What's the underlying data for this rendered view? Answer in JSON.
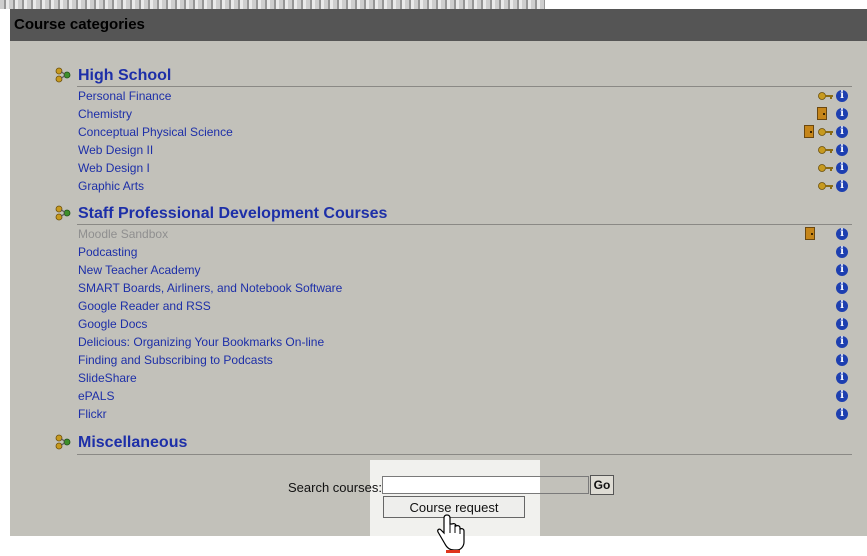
{
  "header": {
    "title": "Course categories"
  },
  "categories": [
    {
      "name": "High School",
      "courses": [
        {
          "name": "Personal Finance",
          "icons": [
            "key-icon",
            "info-icon"
          ]
        },
        {
          "name": "Chemistry",
          "icons": [
            "door-icon",
            "info-icon"
          ]
        },
        {
          "name": "Conceptual Physical Science",
          "icons": [
            "door-icon",
            "key-icon",
            "info-icon"
          ]
        },
        {
          "name": "Web Design II",
          "icons": [
            "key-icon",
            "info-icon"
          ]
        },
        {
          "name": "Web Design I",
          "icons": [
            "key-icon",
            "info-icon"
          ]
        },
        {
          "name": "Graphic Arts",
          "icons": [
            "key-icon",
            "info-icon"
          ]
        }
      ]
    },
    {
      "name": "Staff Professional Development Courses",
      "courses": [
        {
          "name": "Moodle Sandbox",
          "hidden": true,
          "icons": [
            "door-icon",
            "info-icon"
          ]
        },
        {
          "name": "Podcasting",
          "icons": [
            "info-icon"
          ]
        },
        {
          "name": "New Teacher Academy",
          "icons": [
            "info-icon"
          ]
        },
        {
          "name": "SMART Boards, Airliners, and Notebook Software",
          "icons": [
            "info-icon"
          ]
        },
        {
          "name": "Google Reader and RSS",
          "icons": [
            "info-icon"
          ]
        },
        {
          "name": "Google Docs",
          "icons": [
            "info-icon"
          ]
        },
        {
          "name": "Delicious: Organizing Your Bookmarks On-line",
          "icons": [
            "info-icon"
          ]
        },
        {
          "name": "Finding and Subscribing to Podcasts",
          "icons": [
            "info-icon"
          ]
        },
        {
          "name": "SlideShare",
          "icons": [
            "info-icon"
          ]
        },
        {
          "name": "ePALS",
          "icons": [
            "info-icon"
          ]
        },
        {
          "name": "Flickr",
          "icons": [
            "info-icon"
          ]
        }
      ]
    },
    {
      "name": "Miscellaneous",
      "courses": []
    }
  ],
  "search": {
    "label": "Search courses:",
    "value": "",
    "go_label": "Go",
    "course_request_label": "Course request"
  },
  "colors": {
    "link": "#1d2fa8",
    "panel": "#c2c1ba",
    "header": "#555555",
    "info": "#1d3fb0"
  }
}
